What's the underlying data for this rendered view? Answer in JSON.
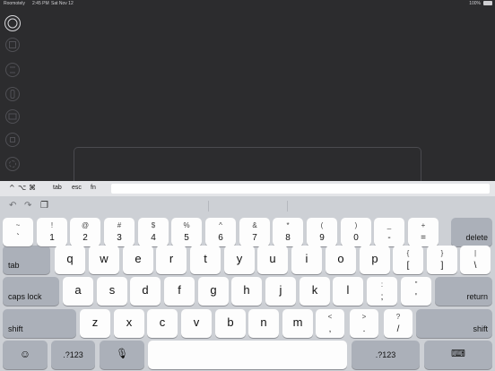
{
  "status_bar": {
    "carrier": "Roomotely",
    "time": "2:45 PM",
    "date": "Sat Nov 12",
    "battery": "100%"
  },
  "sidebar": {
    "items": [
      {
        "icon": "circle-icon",
        "active": true
      },
      {
        "icon": "grid-icon",
        "active": false
      },
      {
        "icon": "list-icon",
        "active": false
      },
      {
        "icon": "remote-icon",
        "active": false
      },
      {
        "icon": "monitor-icon",
        "active": false
      },
      {
        "icon": "volume-icon",
        "active": false
      },
      {
        "icon": "settings-icon",
        "active": false
      }
    ]
  },
  "modifier_bar": {
    "ctrl": "^",
    "option": "⌥",
    "command": "⌘",
    "tab": "tab",
    "esc": "esc",
    "fn": "fn",
    "input_value": ""
  },
  "keyboard": {
    "row1": [
      {
        "sec": "~",
        "pri": "`"
      },
      {
        "sec": "!",
        "pri": "1"
      },
      {
        "sec": "@",
        "pri": "2"
      },
      {
        "sec": "#",
        "pri": "3"
      },
      {
        "sec": "$",
        "pri": "4"
      },
      {
        "sec": "%",
        "pri": "5"
      },
      {
        "sec": "^",
        "pri": "6"
      },
      {
        "sec": "&",
        "pri": "7"
      },
      {
        "sec": "*",
        "pri": "8"
      },
      {
        "sec": "(",
        "pri": "9"
      },
      {
        "sec": ")",
        "pri": "0"
      },
      {
        "sec": "_",
        "pri": "-"
      },
      {
        "sec": "+",
        "pri": "="
      }
    ],
    "delete": "delete",
    "tab": "tab",
    "row2": [
      "q",
      "w",
      "e",
      "r",
      "t",
      "y",
      "u",
      "i",
      "o",
      "p"
    ],
    "row2_sym": [
      {
        "sec": "{",
        "pri": "["
      },
      {
        "sec": "}",
        "pri": "]"
      },
      {
        "sec": "|",
        "pri": "\\"
      }
    ],
    "caps_lock": "caps lock",
    "row3": [
      "a",
      "s",
      "d",
      "f",
      "g",
      "h",
      "j",
      "k",
      "l"
    ],
    "row3_sym": [
      {
        "sec": ":",
        "pri": ";"
      },
      {
        "sec": "\"",
        "pri": "'"
      }
    ],
    "return": "return",
    "shift_left": "shift",
    "row4": [
      "z",
      "x",
      "c",
      "v",
      "b",
      "n",
      "m"
    ],
    "row4_sym": [
      {
        "sec": "<",
        "pri": ","
      },
      {
        "sec": ">",
        "pri": "."
      },
      {
        "sec": "?",
        "pri": "/"
      }
    ],
    "shift_right": "shift",
    "numbers_left": ".?123",
    "numbers_right": ".?123"
  }
}
